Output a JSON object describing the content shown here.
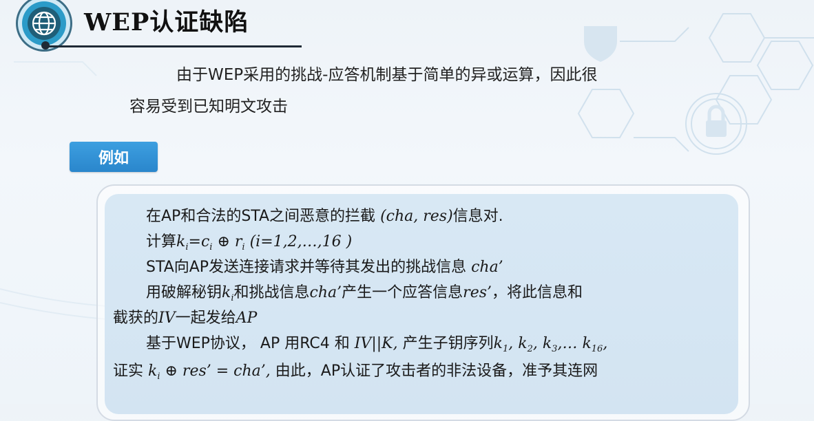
{
  "title": "WEP认证缺陷",
  "intro": {
    "line1": "由于WEP采用的挑战-应答机制基于简单的异或运算，因此很",
    "line2": "容易受到已知明文攻击"
  },
  "tag": "例如",
  "steps": {
    "s1_text": "在AP和合法的STA之间恶意的拦截",
    "s1_math": "(cha, res)",
    "s1_tail": "信息对.",
    "s2_text": "计算",
    "s2_k": "k",
    "s2_sub_i": "i",
    "s2_eq": "=c",
    "s2_sub_i2": "i",
    "s2_xor": " ⊕ r",
    "s2_sub_i3": "i",
    "s2_range": "  (i=1,2,…,16 )",
    "s3_text": "STA向AP发送连接请求并等待其发出的挑战信息",
    "s3_math": "cha’",
    "s4_a": "用破解秘钥",
    "s4_k": "k",
    "s4_sub": "i",
    "s4_b": "和挑战信息",
    "s4_cha": "cha’",
    "s4_c": "产生一个应答信息",
    "s4_res": "res’",
    "s4_d": "，将此信息和",
    "s5_a": "截获的",
    "s5_iv": "IV",
    "s5_b": "一起发给",
    "s5_ap": "AP",
    "s6_a": "基于WEP协议， AP 用RC4 和",
    "s6_ivk": " IV||K, ",
    "s6_b": "产生子钥序列",
    "s6_seq": "k",
    "s6_s1": "1",
    "s6_seq2": ", k",
    "s6_s2": "2",
    "s6_seq3": ", k",
    "s6_s3": "3",
    "s6_seq4": ",… k",
    "s6_s16": "16",
    "s6_end": ",",
    "s7_a": "证实 ",
    "s7_k": "k",
    "s7_sub": "i",
    "s7_eq": " ⊕ res’ = cha’,",
    "s7_b": " 由此，AP认证了攻击者的非法设备，准予其连网"
  },
  "colors": {
    "tag_bg": "#2a86cc",
    "globe": "#2b9bc8",
    "panel": "#d6e6f3"
  }
}
